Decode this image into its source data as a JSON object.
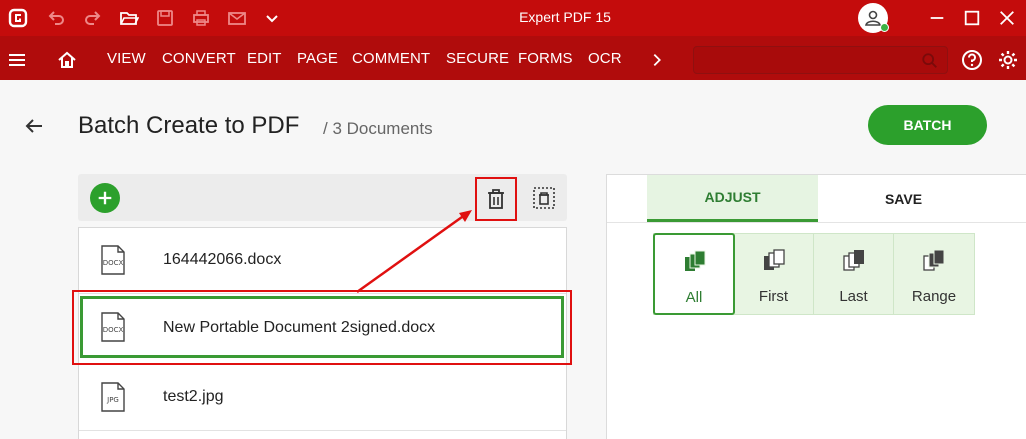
{
  "app": {
    "title": "Expert PDF 15"
  },
  "menu": {
    "items": [
      "VIEW",
      "CONVERT",
      "EDIT",
      "PAGE",
      "COMMENT",
      "SECURE",
      "FORMS",
      "OCR"
    ],
    "search": {
      "placeholder": ""
    }
  },
  "page": {
    "title": "Batch Create to PDF",
    "subtitle": "/ 3 Documents",
    "batch_label": "BATCH"
  },
  "files": [
    {
      "name": "164442066.docx",
      "type": "DOCX",
      "selected": false
    },
    {
      "name": "New Portable Document 2signed.docx",
      "type": "DOCX",
      "selected": true
    },
    {
      "name": "test2.jpg",
      "type": "JPG",
      "selected": false
    }
  ],
  "panel": {
    "tabs": [
      "ADJUST",
      "SAVE"
    ],
    "active_tab": "ADJUST",
    "options": [
      "All",
      "First",
      "Last",
      "Range"
    ],
    "active_option": "All"
  },
  "colors": {
    "titlebar": "#c40c0c",
    "menubar": "#b00c0c",
    "accent_green": "#2ca02c",
    "annotation_red": "#e01010"
  }
}
